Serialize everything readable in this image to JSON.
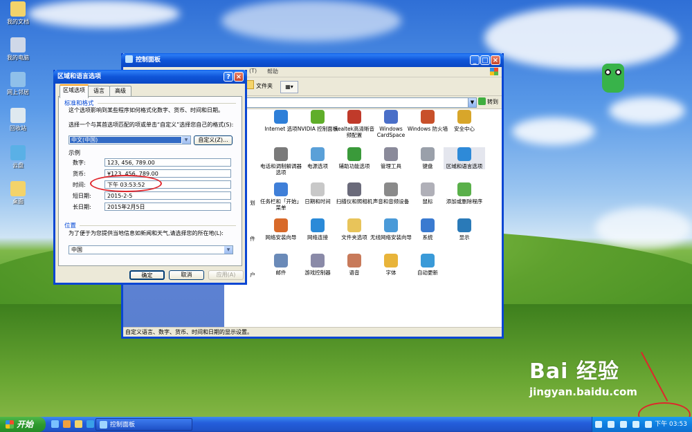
{
  "desktop": {
    "icons": [
      {
        "label": "我的文档",
        "icon": "my-documents-icon"
      },
      {
        "label": "我的电脑",
        "icon": "my-computer-icon"
      },
      {
        "label": "网上邻居",
        "icon": "network-places-icon"
      },
      {
        "label": "回收站",
        "icon": "recycle-bin-icon"
      },
      {
        "label": "云盘",
        "icon": "cloud-disk-icon"
      },
      {
        "label": "桌面",
        "icon": "desktop-folder-icon"
      }
    ]
  },
  "control_panel": {
    "title": "控制面板",
    "menu": {
      "help": "帮助",
      "other": "(T)"
    },
    "toolbar": {
      "folders": "文件夹"
    },
    "address": {
      "go": "转到"
    },
    "items": [
      {
        "label": "Internet 选项",
        "color": "#2e7fd8"
      },
      {
        "label": "NVIDIA 控制面板",
        "color": "#5fae2a"
      },
      {
        "label": "Realtek高清晰音频配置",
        "color": "#c03a2a"
      },
      {
        "label": "Windows CardSpace",
        "color": "#4a6fc8"
      },
      {
        "label": "Windows 防火墙",
        "color": "#c8502a"
      },
      {
        "label": "安全中心",
        "color": "#d8a62a"
      },
      {
        "label": "电话和调制解调器选项",
        "color": "#7a7a7a"
      },
      {
        "label": "电源选项",
        "color": "#5aa0d8"
      },
      {
        "label": "辅助功能选项",
        "color": "#3a9a3a"
      },
      {
        "label": "管理工具",
        "color": "#8a8a9a"
      },
      {
        "label": "键盘",
        "color": "#9aa0aa"
      },
      {
        "label": "区域和语言选项",
        "color": "#2e8ad8"
      },
      {
        "label": "任务栏和「开始」菜单",
        "color": "#3f7fd8"
      },
      {
        "label": "日期和时间",
        "color": "#c8c8c8"
      },
      {
        "label": "扫描仪和照相机",
        "color": "#6a6a7a"
      },
      {
        "label": "声音和音频设备",
        "color": "#8a8a8a"
      },
      {
        "label": "鼠标",
        "color": "#b0b0b8"
      },
      {
        "label": "添加或删除程序",
        "color": "#5ab04a"
      },
      {
        "label": "网络安装向导",
        "color": "#d86a2a"
      },
      {
        "label": "网络连接",
        "color": "#2a8ad8"
      },
      {
        "label": "文件夹选项",
        "color": "#e8c45a"
      },
      {
        "label": "无线网络安装向导",
        "color": "#4a9ad8"
      },
      {
        "label": "系统",
        "color": "#3a7ad0"
      },
      {
        "label": "显示",
        "color": "#2a7ab8"
      },
      {
        "label": "邮件",
        "color": "#6a8ab8"
      },
      {
        "label": "游戏控制器",
        "color": "#8a8aa8"
      },
      {
        "label": "语音",
        "color": "#c87a5a"
      },
      {
        "label": "字体",
        "color": "#e8b43a"
      },
      {
        "label": "自动更新",
        "color": "#3a9ad8"
      }
    ],
    "partial_labels": [
      "划",
      "件",
      "户"
    ],
    "status": "自定义语言、数字、货币、时间和日期的显示设置。"
  },
  "dialog": {
    "title": "区域和语言选项",
    "tabs": [
      "区域选项",
      "语言",
      "高级"
    ],
    "standards": {
      "title": "标准和格式",
      "desc": "这个选项影响到某些程序如何格式化数字、货币、时间和日期。",
      "select_prompt": "选择一个与其首选项匹配的项或单击“自定义”选择您自己的格式(S):",
      "selected": "中文(中国)",
      "customize": "自定义(Z)..."
    },
    "samples": {
      "title": "示例",
      "rows": [
        {
          "label": "数字:",
          "value": "123, 456, 789.00"
        },
        {
          "label": "货币:",
          "value": "¥123, 456, 789.00"
        },
        {
          "label": "时间:",
          "value": "下午 03:53:52"
        },
        {
          "label": "短日期:",
          "value": "2015-2-5"
        },
        {
          "label": "长日期:",
          "value": "2015年2月5日"
        }
      ]
    },
    "location": {
      "title": "位置",
      "desc": "为了便于为您提供当地信息如新闻和天气,请选择您的所在地(L):",
      "selected": "中国"
    },
    "buttons": {
      "ok": "确定",
      "cancel": "取消",
      "apply": "应用(A)"
    }
  },
  "taskbar": {
    "start": "开始",
    "task": "控制面板",
    "clock": "下午 03:53"
  },
  "watermark": {
    "brand": "Bai 经验",
    "url": "jingyan.baidu.com"
  }
}
